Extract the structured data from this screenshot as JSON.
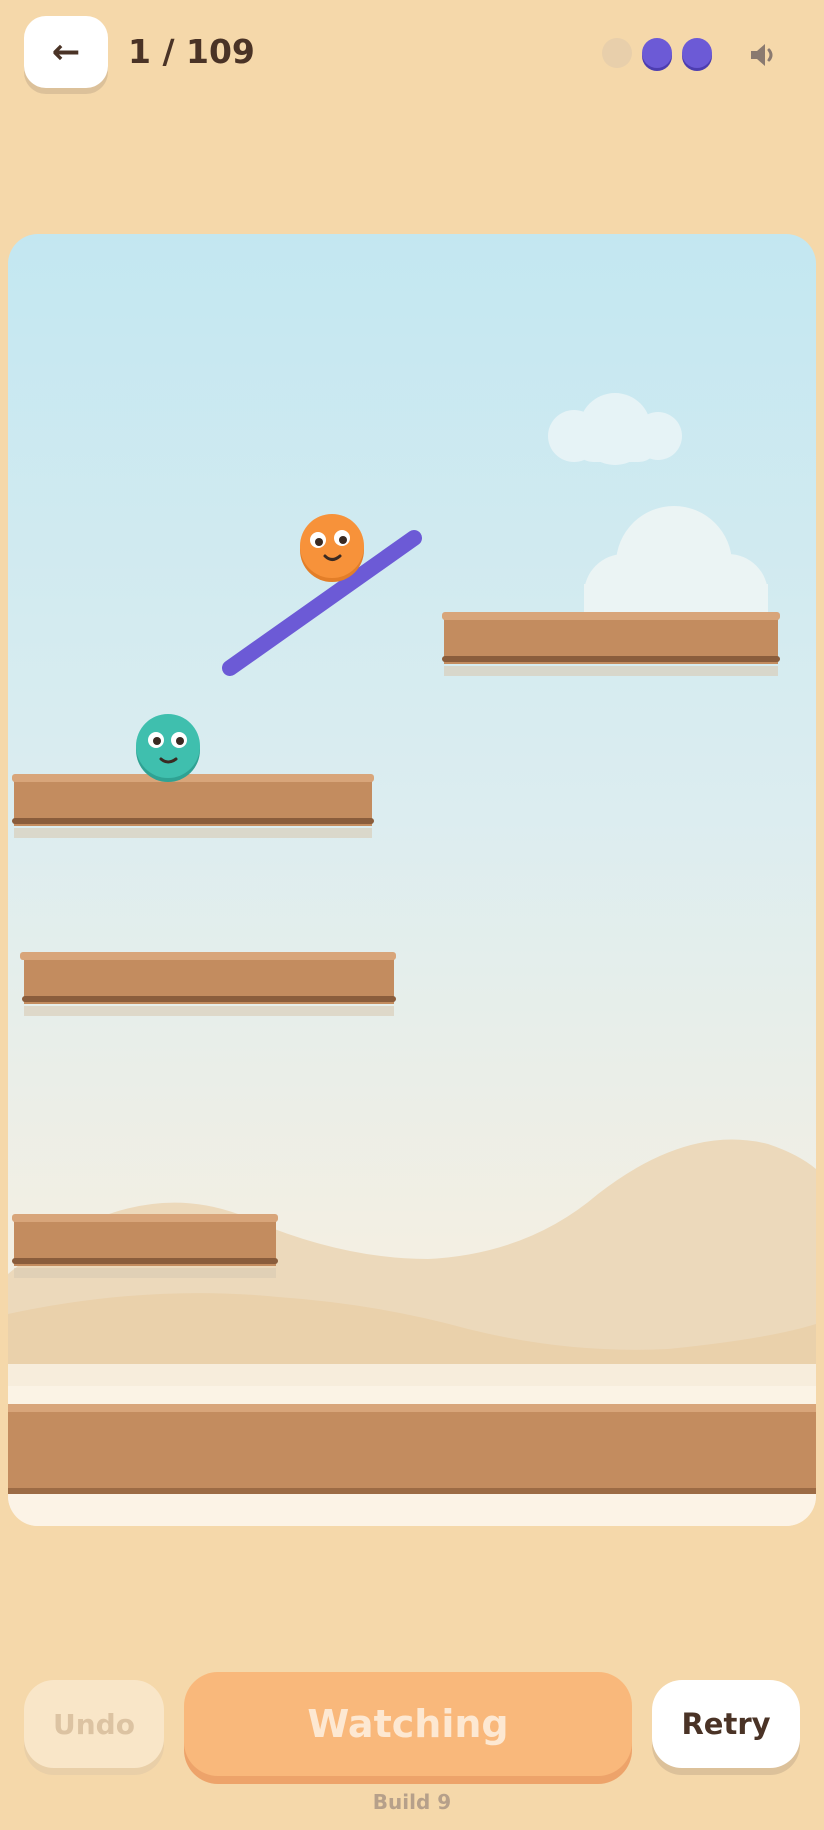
{
  "header": {
    "back_icon": "left-arrow-icon",
    "back_glyph": "←",
    "level_label": "1 / 109",
    "progress_dots": [
      {
        "state": "empty",
        "color": "#e8cfab"
      },
      {
        "state": "filled",
        "color": "#6c5ad6"
      },
      {
        "state": "filled",
        "color": "#6c5ad6"
      }
    ],
    "sound_icon": "speaker-icon"
  },
  "scene": {
    "characters": [
      {
        "name": "orange-ball",
        "color": "#f7923a"
      },
      {
        "name": "teal-ball",
        "color": "#3fbfae"
      }
    ],
    "drawn_line_color": "#6c5ad6",
    "platform_color": "#c38c5f"
  },
  "controls": {
    "undo_label": "Undo",
    "watching_label": "Watching",
    "retry_label": "Retry"
  },
  "footer": {
    "build_label": "Build 9"
  },
  "colors": {
    "background": "#f5d8aa",
    "accent": "#6c5ad6",
    "primary_button": "#f9b87b"
  }
}
